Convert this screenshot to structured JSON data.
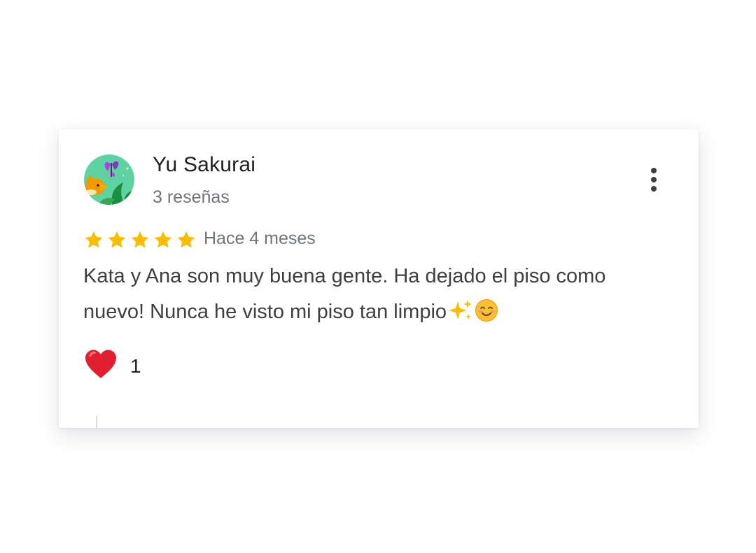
{
  "review": {
    "author_name": "Yu Sakurai",
    "author_reviews": "3 reseñas",
    "avatar_icon": "fox-butterfly-avatar-icon",
    "rating": 5,
    "rating_max": 5,
    "time_ago": "Hace 4 meses",
    "text": "Kata y Ana son muy buena gente. Ha dejado el piso como nuevo! Nunca he visto mi piso tan limpio",
    "text_emojis": [
      "sparkles-icon",
      "smiling-face-icon"
    ],
    "more_options_icon": "more-vert-icon",
    "reaction": {
      "icon": "heart-icon",
      "count": "1"
    }
  },
  "colors": {
    "star": "#fbbc04",
    "heart": "#e0202e",
    "avatar_bg": "#5ed3a1",
    "text": "#3c4043",
    "secondary_text": "#70757a"
  }
}
